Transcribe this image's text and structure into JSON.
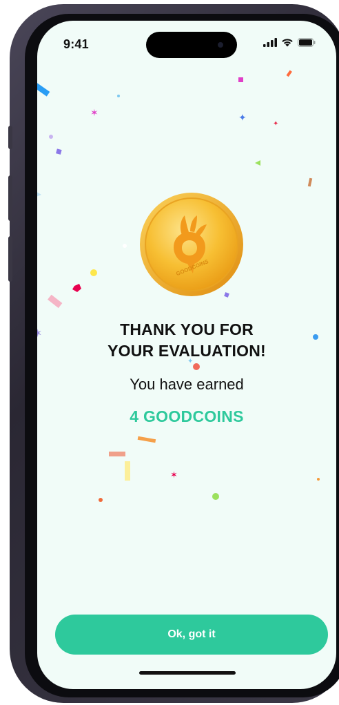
{
  "status_bar": {
    "time": "9:41",
    "icons": [
      "signal-icon",
      "wifi-icon",
      "battery-icon"
    ]
  },
  "reward_screen": {
    "coin_logo_text": "GOODCOINS",
    "title_line1": "THANK YOU FOR",
    "title_line2": "YOUR EVALUATION!",
    "subtitle": "You have earned",
    "reward": "4 GOODCOINS"
  },
  "actions": {
    "confirm_label": "Ok, got it"
  },
  "colors": {
    "accent": "#2ec99c",
    "background": "#f1fcf8",
    "coin_gold": "#f5b82a",
    "text": "#111111"
  }
}
